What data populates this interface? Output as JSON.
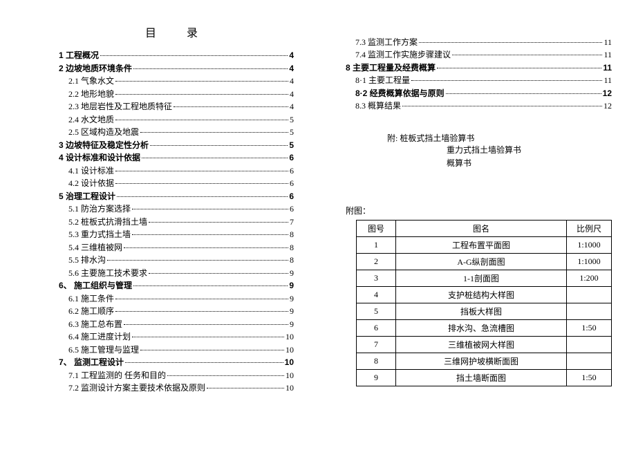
{
  "title": "目　录",
  "left": [
    {
      "num": "1",
      "t": "工程概况",
      "p": "4",
      "b": 1,
      "i": 0
    },
    {
      "num": "2",
      "t": "边坡地质环境条件",
      "p": "4",
      "b": 1,
      "i": 0
    },
    {
      "num": "2.1",
      "t": "气象水文",
      "p": "4",
      "b": 0,
      "i": 1
    },
    {
      "num": "2.2",
      "t": "地形地貌",
      "p": "4",
      "b": 0,
      "i": 1
    },
    {
      "num": "2.3",
      "t": "地层岩性及工程地质特征",
      "p": "4",
      "b": 0,
      "i": 1
    },
    {
      "num": "2.4",
      "t": "水文地质",
      "p": "5",
      "b": 0,
      "i": 1
    },
    {
      "num": "2.5",
      "t": "区域构造及地震",
      "p": "5",
      "b": 0,
      "i": 1
    },
    {
      "num": "3",
      "t": "边坡特征及稳定性分析",
      "p": "5",
      "b": 1,
      "i": 0
    },
    {
      "num": "4",
      "t": "设计标准和设计依据",
      "p": "6",
      "b": 1,
      "i": 0
    },
    {
      "num": "4.1",
      "t": "设计标准",
      "p": "6",
      "b": 0,
      "i": 1
    },
    {
      "num": "4.2",
      "t": "设计依据",
      "p": "6",
      "b": 0,
      "i": 1
    },
    {
      "num": "5",
      "t": "治理工程设计",
      "p": "6",
      "b": 1,
      "i": 0
    },
    {
      "num": "5.1",
      "t": "防治方案选择",
      "p": "6",
      "b": 0,
      "i": 1
    },
    {
      "num": "5.2",
      "t": "桩板式抗滑挡土墙",
      "p": "7",
      "b": 0,
      "i": 1
    },
    {
      "num": "5.3",
      "t": "重力式挡土墙",
      "p": "8",
      "b": 0,
      "i": 1
    },
    {
      "num": "5.4",
      "t": "三维植被网",
      "p": "8",
      "b": 0,
      "i": 1
    },
    {
      "num": "5.5",
      "t": "排水沟",
      "p": "8",
      "b": 0,
      "i": 1
    },
    {
      "num": "5.6",
      "t": "主要施工技术要求",
      "p": "9",
      "b": 0,
      "i": 1
    },
    {
      "num": "6、",
      "t": "施工组织与管理",
      "p": "9",
      "b": 1,
      "i": 0
    },
    {
      "num": "6.1",
      "t": "施工条件",
      "p": "9",
      "b": 0,
      "i": 1
    },
    {
      "num": "6.2",
      "t": "施工顺序",
      "p": "9",
      "b": 0,
      "i": 1
    },
    {
      "num": "6.3",
      "t": "施工总布置",
      "p": "9",
      "b": 0,
      "i": 1
    },
    {
      "num": "6.4",
      "t": "施工进度计划",
      "p": "10",
      "b": 0,
      "i": 1
    },
    {
      "num": "6.5",
      "t": "施工管理与监理",
      "p": "10",
      "b": 0,
      "i": 1
    },
    {
      "num": "7、",
      "t": "监测工程设计",
      "p": "10",
      "b": 1,
      "i": 0
    },
    {
      "num": "7.1",
      "t": "工程监测的 任务和目的",
      "p": "10",
      "b": 0,
      "i": 1
    },
    {
      "num": "7.2",
      "t": "监测设计方案主要技术依据及原则",
      "p": "10",
      "b": 0,
      "i": 1
    }
  ],
  "right": [
    {
      "num": "7.3",
      "t": "监测工作方案",
      "p": "11",
      "b": 0,
      "i": 1
    },
    {
      "num": "7.4",
      "t": "监测工作实施步骤建议",
      "p": "11",
      "b": 0,
      "i": 1
    },
    {
      "num": "8",
      "t": "主要工程量及经费概算",
      "p": "11",
      "b": 1,
      "i": 0
    },
    {
      "num": "8·1",
      "t": "主要工程量",
      "p": "11",
      "b": 0,
      "i": 1
    },
    {
      "num": "8·2",
      "t": "经费概算依据与原则",
      "p": "12",
      "b": 1,
      "i": 1
    },
    {
      "num": "8.3",
      "t": "概算结果",
      "p": "12",
      "b": 0,
      "i": 1
    }
  ],
  "fujian": {
    "prefix": "附:",
    "lines": [
      "桩板式挡土墙验算书",
      "重力式挡土墙验算书",
      "概算书"
    ]
  },
  "futu_label": "附图：",
  "tbl_head": {
    "c1": "图号",
    "c2": "图名",
    "c3": "比例尺"
  },
  "tbl": [
    {
      "no": "1",
      "name": "工程布置平面图",
      "scale": "1:1000"
    },
    {
      "no": "2",
      "name": "A-G纵剖面图",
      "scale": "1:1000"
    },
    {
      "no": "3",
      "name": "1-1剖面图",
      "scale": "1:200"
    },
    {
      "no": "4",
      "name": "支护桩结构大样图",
      "scale": ""
    },
    {
      "no": "5",
      "name": "挡板大样图",
      "scale": ""
    },
    {
      "no": "6",
      "name": "排水沟、急流槽图",
      "scale": "1:50"
    },
    {
      "no": "7",
      "name": "三维植被网大样图",
      "scale": ""
    },
    {
      "no": "8",
      "name": "三维网护坡横断面图",
      "scale": ""
    },
    {
      "no": "9",
      "name": "挡土墙断面图",
      "scale": "1:50"
    }
  ]
}
